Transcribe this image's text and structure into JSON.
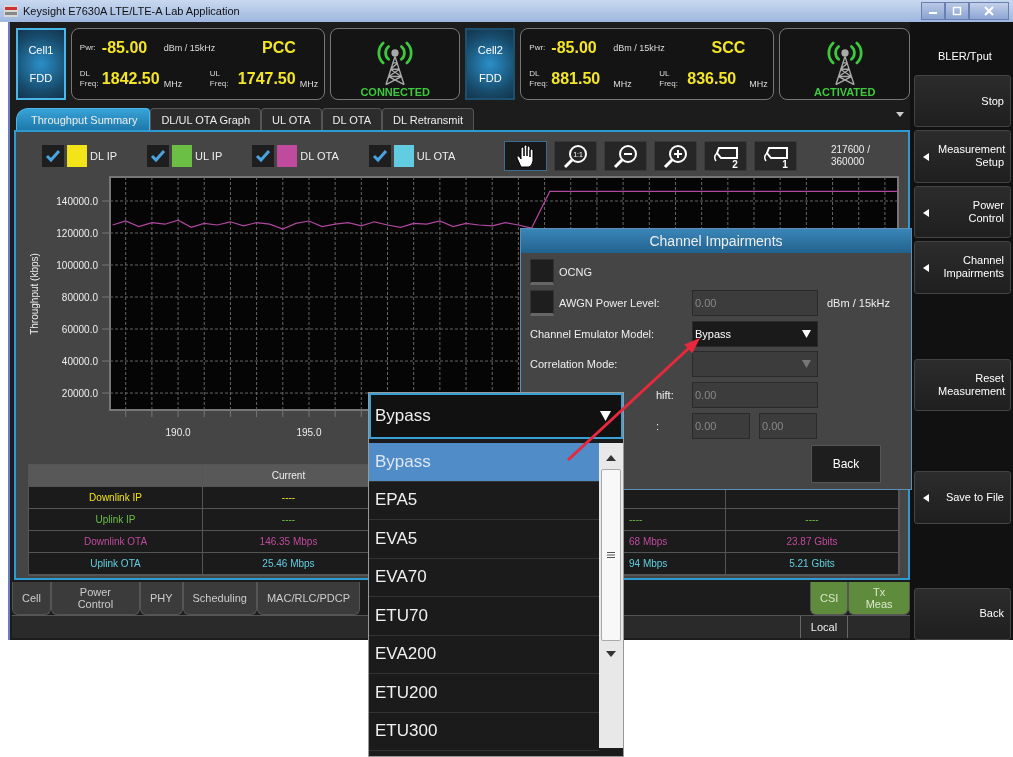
{
  "window": {
    "title": "Keysight E7630A LTE/LTE-A Lab Application"
  },
  "cells": [
    {
      "name": "Cell1",
      "duplex": "FDD",
      "selected": true,
      "pwr_label": "Pwr:",
      "pwr": "-85.00",
      "pwr_unit": "dBm / 15kHz",
      "role": "PCC",
      "dl_label": "DL Freq:",
      "dl": "1842.50",
      "dl_unit": "MHz",
      "ul_label": "UL Freq:",
      "ul": "1747.50",
      "ul_unit": "MHz",
      "status": "CONNECTED"
    },
    {
      "name": "Cell2",
      "duplex": "FDD",
      "selected": false,
      "pwr_label": "Pwr:",
      "pwr": "-85.00",
      "pwr_unit": "dBm / 15kHz",
      "role": "SCC",
      "dl_label": "DL Freq:",
      "dl": "881.50",
      "dl_unit": "MHz",
      "ul_label": "UL Freq:",
      "ul": "836.50",
      "ul_unit": "MHz",
      "status": "ACTIVATED"
    }
  ],
  "tabs": [
    {
      "label": "Throughput Summary",
      "selected": true
    },
    {
      "label": "DL/UL OTA Graph",
      "selected": false
    },
    {
      "label": "UL OTA",
      "selected": false
    },
    {
      "label": "DL OTA",
      "selected": false
    },
    {
      "label": "DL Retransmit",
      "selected": false
    }
  ],
  "legend": [
    {
      "label": "DL IP",
      "color": "#f2e418",
      "checked": true
    },
    {
      "label": "UL IP",
      "color": "#6cbf45",
      "checked": true
    },
    {
      "label": "DL OTA",
      "color": "#c04a9e",
      "checked": true
    },
    {
      "label": "UL OTA",
      "color": "#62cde0",
      "checked": true
    }
  ],
  "toolbar": [
    {
      "kind": "pan",
      "selected": true
    },
    {
      "kind": "zoom-fit",
      "label": "1:1",
      "selected": false
    },
    {
      "kind": "zoom-out",
      "selected": false
    },
    {
      "kind": "zoom-in",
      "selected": false
    },
    {
      "kind": "marker",
      "label": "2",
      "selected": false
    },
    {
      "kind": "marker",
      "label": "1",
      "selected": false
    }
  ],
  "counter": "217600 / 360000",
  "chart": {
    "chart_data": {
      "type": "line",
      "grid": true,
      "ylabel": "Throughput (kbps)",
      "xlim": [
        187.4,
        217.5
      ],
      "ylim": [
        9400,
        155000
      ],
      "xticks": [
        {
          "value": 190,
          "label": "190.0"
        },
        {
          "value": 195,
          "label": "195.0"
        }
      ],
      "yticks": [
        {
          "value": 20000,
          "label": "20000.0"
        },
        {
          "value": 40000,
          "label": "40000.0"
        },
        {
          "value": 60000,
          "label": "60000.0"
        },
        {
          "value": 80000,
          "label": "80000.0"
        },
        {
          "value": 100000,
          "label": "100000.0"
        },
        {
          "value": 120000,
          "label": "120000.0"
        },
        {
          "value": 140000,
          "label": "140000.0"
        }
      ],
      "x": [
        187.5,
        188,
        188.5,
        189,
        189.5,
        190,
        190.5,
        191,
        191.5,
        192,
        192.5,
        193,
        193.5,
        194,
        194.5,
        195,
        195.5,
        196,
        196.5,
        197,
        197.5,
        198,
        198.5,
        199,
        199.5,
        200,
        200.5,
        201,
        201.5,
        202,
        202.5,
        203,
        203.5,
        204.2,
        217.5
      ],
      "series": [
        {
          "color": "#b0479e",
          "values": [
            125000,
            127500,
            124000,
            126500,
            125500,
            128000,
            123500,
            126000,
            125000,
            127000,
            124500,
            126500,
            125500,
            122500,
            126000,
            127500,
            124000,
            125500,
            126500,
            124500,
            127000,
            125000,
            123500,
            126000,
            125500,
            127500,
            124000,
            126000,
            125000,
            124500,
            126500,
            125000,
            123000,
            146000,
            146000
          ]
        }
      ]
    }
  },
  "table": {
    "columns": [
      {
        "heading": "Current"
      }
    ],
    "rows": [
      {
        "label": "Downlink IP",
        "current": "----"
      },
      {
        "label": "Uplink IP",
        "current": "----",
        "column_4": "----",
        "column_5": "----"
      },
      {
        "label": "Downlink OTA",
        "current": "146.35 Mbps",
        "column_4": "68 Mbps",
        "column_5": "23.87 Gbits"
      },
      {
        "label": "Uplink OTA",
        "current": "25.46 Mbps",
        "column_4": "94 Mbps",
        "column_5": "5.21 Gbits"
      }
    ]
  },
  "bottom_tabs_left": [
    {
      "label": "Cell",
      "kind": "plain"
    },
    {
      "label": "Power Control",
      "kind": "plain"
    },
    {
      "label": "PHY",
      "kind": "plain"
    },
    {
      "label": "Scheduling",
      "kind": "plain"
    },
    {
      "label": "MAC/RLC/PDCP",
      "kind": "plain"
    }
  ],
  "bottom_tabs_right": [
    {
      "label": "CSI",
      "kind": "green"
    },
    {
      "label": "Tx Meas",
      "kind": "green"
    }
  ],
  "status_bar": {
    "mode": "Local"
  },
  "sidebar": {
    "title": "BLER/Tput",
    "buttons": [
      {
        "label": "Stop",
        "submenu": false
      },
      {
        "label": "Measurement Setup",
        "submenu": true
      },
      {
        "label": "Power Control",
        "submenu": true
      },
      {
        "label": "Channel Impairments",
        "submenu": true
      },
      {
        "label": "Reset Measurement",
        "submenu": false
      },
      {
        "label": "Save to File",
        "submenu": true
      },
      {
        "label": "Back",
        "submenu": false
      }
    ]
  },
  "dialog": {
    "title": "Channel Impairments",
    "rows": [
      {
        "kind": "checkbox",
        "label": "OCNG",
        "checked": false
      },
      {
        "kind": "checkbox-field",
        "label": "AWGN Power Level:",
        "checked": false,
        "values": [
          "0.00"
        ],
        "unit": "dBm / 15kHz"
      },
      {
        "kind": "select",
        "label": "Channel Emulator Model:",
        "value": "Bypass",
        "disabled": false
      },
      {
        "kind": "select",
        "label": "Correlation Mode:",
        "disabled": true
      },
      {
        "kind": "field",
        "label": "hift:",
        "cut": true,
        "values": [
          "0.00"
        ]
      },
      {
        "kind": "field",
        "label": ":",
        "cut": true,
        "values": [
          "0.00",
          "0.00"
        ]
      }
    ],
    "back_button": "Back"
  },
  "dropdown": {
    "value": "Bypass",
    "options": [
      {
        "label": "Bypass",
        "selected": true
      },
      {
        "label": "EPA5",
        "selected": false
      },
      {
        "label": "EVA5",
        "selected": false
      },
      {
        "label": "EVA70",
        "selected": false
      },
      {
        "label": "ETU70",
        "selected": false
      },
      {
        "label": "EVA200",
        "selected": false
      },
      {
        "label": "ETU200",
        "selected": false
      },
      {
        "label": "ETU300",
        "selected": false
      }
    ]
  }
}
